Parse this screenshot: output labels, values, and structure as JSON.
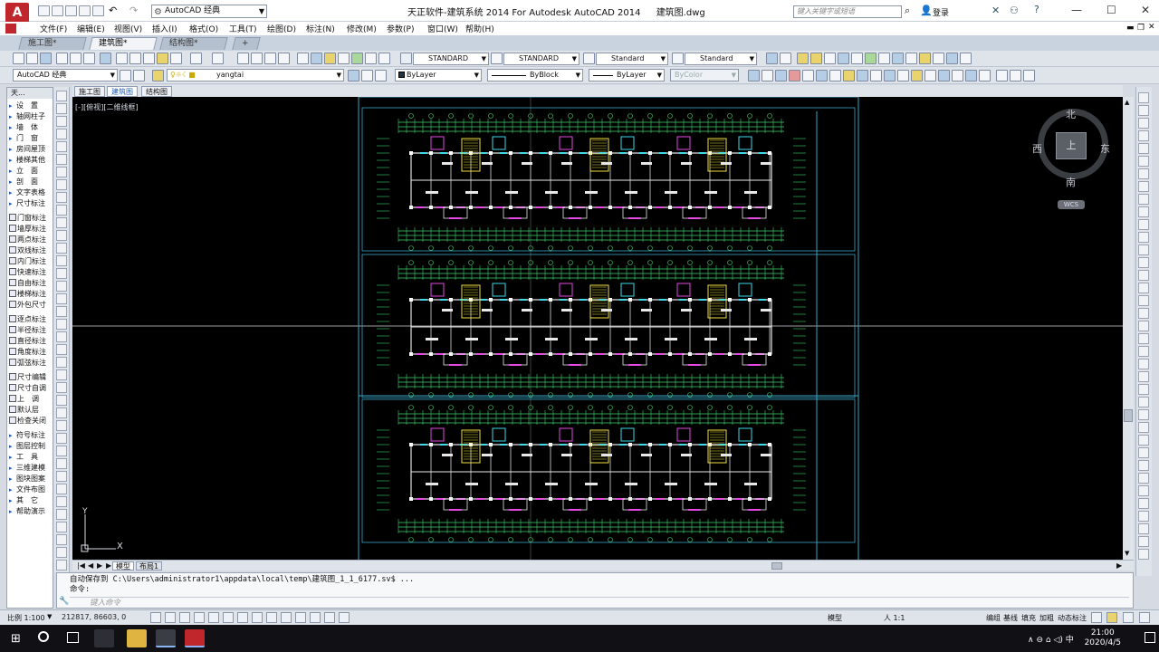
{
  "title_bar": {
    "app_logo": "A",
    "workspace": "AutoCAD 经典",
    "app_title": "天正软件-建筑系统 2014  For Autodesk AutoCAD 2014",
    "file_name": "建筑图.dwg",
    "search_placeholder": "键入关键字或短语",
    "login": "登录"
  },
  "menu": [
    "文件(F)",
    "编辑(E)",
    "视图(V)",
    "插入(I)",
    "格式(O)",
    "工具(T)",
    "绘图(D)",
    "标注(N)",
    "修改(M)",
    "参数(P)",
    "窗口(W)",
    "帮助(H)"
  ],
  "file_tabs": [
    "施工图*",
    "建筑图*",
    "结构图*"
  ],
  "toolbar": {
    "text_style": "STANDARD",
    "dim_style": "STANDARD",
    "table_style": "Standard",
    "mleader_style": "Standard",
    "workspace2": "AutoCAD 经典",
    "layer": "yangtai",
    "color": "ByLayer",
    "linetype": "ByBlock",
    "lineweight": "ByLayer",
    "plotstyle": "ByColor"
  },
  "palette": {
    "title": "天...",
    "groups": [
      [
        "设　置",
        "轴网柱子",
        "墙　体",
        "门　窗",
        "房间屋顶",
        "楼梯其他",
        "立　面",
        "剖　面",
        "文字表格",
        "尺寸标注"
      ],
      [
        "门窗标注",
        "墙厚标注",
        "两点标注",
        "双线标注",
        "内门标注",
        "快速标注",
        "自由标注",
        "楼梯标注",
        "外包尺寸"
      ],
      [
        "逐点标注",
        "半径标注",
        "直径标注",
        "角度标注",
        "弧弦标注"
      ],
      [
        "尺寸编辑",
        "尺寸自调",
        "上　调",
        "默认层",
        "检查关闭"
      ],
      [
        "符号标注",
        "图层控制",
        "工　具",
        "三维建模",
        "图块图案",
        "文件布图",
        "其　它",
        "帮助演示"
      ]
    ]
  },
  "layout_tabs_top": [
    "施工图",
    "建筑图",
    "结构图"
  ],
  "view_label": "[-][俯视][二维线框]",
  "viewcube": {
    "n": "北",
    "s": "南",
    "w": "西",
    "e": "东",
    "face": "上",
    "wcs": "WCS"
  },
  "model_tabs": [
    "模型",
    "布局1"
  ],
  "command": {
    "history_line": "自动保存到 C:\\Users\\administrator1\\appdata\\local\\temp\\建筑图_1_1_6177.sv$ ...",
    "prompt_line": "命令:",
    "input_placeholder": "键入命令"
  },
  "status": {
    "scale": "比例 1:100",
    "coords": "212817, 86603, 0",
    "model": "模型",
    "annotation_scale": "人 1:1",
    "items": [
      "编组",
      "基线",
      "填充",
      "加粗",
      "动态标注"
    ]
  },
  "taskbar": {
    "time": "21:00",
    "date": "2020/4/5"
  }
}
